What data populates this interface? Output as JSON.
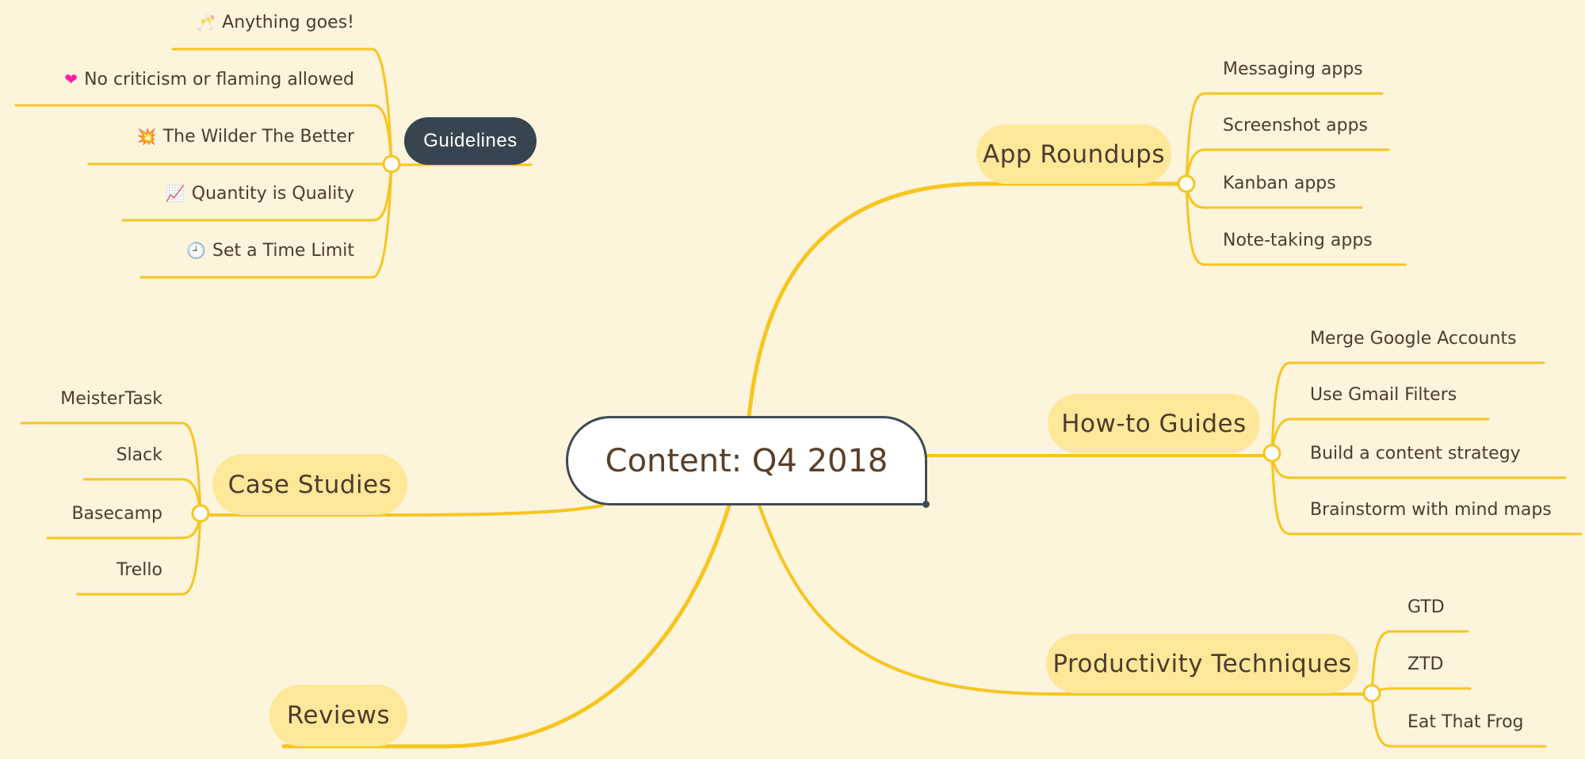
{
  "colors": {
    "background": "#fdf4dc",
    "branch_line": "#f7c51e",
    "topic_fill": "#fde89a",
    "guidelines_fill": "#36454f",
    "text": "#4e3b2c",
    "central_border": "#3f4b55"
  },
  "central": {
    "title": "Content: Q4 2018"
  },
  "topics": {
    "guidelines": {
      "label": "Guidelines",
      "children": [
        {
          "icon": "champagne-icon",
          "glyph": "🥂",
          "label": "Anything goes!"
        },
        {
          "icon": "heart-icon",
          "glyph": "❤",
          "label": "No criticism or flaming allowed"
        },
        {
          "icon": "explosion-icon",
          "glyph": "💥",
          "label": "The Wilder The Better"
        },
        {
          "icon": "chart-up-icon",
          "glyph": "📈",
          "label": "Quantity is Quality"
        },
        {
          "icon": "clock-icon",
          "glyph": "🕘",
          "label": "Set a Time Limit"
        }
      ]
    },
    "app_roundups": {
      "label": "App Roundups",
      "children": [
        {
          "label": "Messaging apps"
        },
        {
          "label": "Screenshot apps"
        },
        {
          "label": "Kanban apps"
        },
        {
          "label": "Note-taking apps"
        }
      ]
    },
    "how_to_guides": {
      "label": "How-to Guides",
      "children": [
        {
          "label": "Merge Google Accounts"
        },
        {
          "label": "Use Gmail Filters"
        },
        {
          "label": "Build a content strategy"
        },
        {
          "label": "Brainstorm with mind maps"
        }
      ]
    },
    "productivity": {
      "label": "Productivity Techniques",
      "children": [
        {
          "label": "GTD"
        },
        {
          "label": "ZTD"
        },
        {
          "label": "Eat That Frog"
        }
      ]
    },
    "case_studies": {
      "label": "Case Studies",
      "children": [
        {
          "label": "MeisterTask"
        },
        {
          "label": "Slack"
        },
        {
          "label": "Basecamp"
        },
        {
          "label": "Trello"
        }
      ]
    },
    "reviews": {
      "label": "Reviews"
    }
  }
}
